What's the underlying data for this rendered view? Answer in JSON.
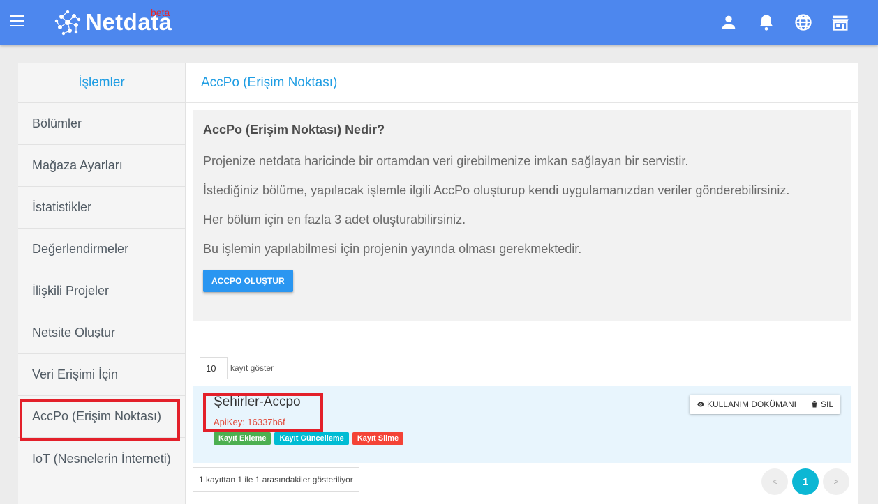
{
  "header": {
    "logo_text": "Netdata",
    "logo_badge": "beta",
    "icons": [
      "menu-icon",
      "user-icon",
      "bell-icon",
      "globe-icon",
      "store-icon"
    ]
  },
  "sidebar": {
    "title": "İşlemler",
    "items": [
      {
        "label": "Bölümler"
      },
      {
        "label": "Mağaza Ayarları"
      },
      {
        "label": "İstatistikler"
      },
      {
        "label": "Değerlendirmeler"
      },
      {
        "label": "İlişkili Projeler"
      },
      {
        "label": "Netsite Oluştur"
      },
      {
        "label": "Veri Erişimi İçin"
      },
      {
        "label": "AccPo (Erişim Noktası)"
      },
      {
        "label": "IoT (Nesnelerin İnterneti)"
      }
    ]
  },
  "content": {
    "title": "AccPo (Erişim Noktası)",
    "info": {
      "heading": "AccPo (Erişim Noktası) Nedir?",
      "p1": "Projenize netdata haricinde bir ortamdan veri girebilmenize imkan sağlayan bir servistir.",
      "p2": "İstediğiniz bölüme, yapılacak işlemle ilgili AccPo oluşturup kendi uygulamanızdan veriler gönderebilirsiniz.",
      "p3": "Her bölüm için en fazla 3 adet oluşturabilirsiniz.",
      "p4": "Bu işlemin yapılabilmesi için projenin yayında olması gerekmektedir.",
      "button": "ACCPO OLUŞTUR"
    },
    "length": {
      "value": "10",
      "label": "kayıt göster"
    },
    "rows": [
      {
        "name": "Şehirler-Accpo",
        "apikey": "ApiKey: 16337b6f",
        "badges": [
          {
            "label": "Kayıt Ekleme",
            "color": "#4caf50"
          },
          {
            "label": "Kayıt Güncelleme",
            "color": "#00bcd4"
          },
          {
            "label": "Kayıt Silme",
            "color": "#f44336"
          }
        ],
        "doc_button": "KULLANIM DOKÜMANI",
        "delete_button": "SIL"
      }
    ],
    "info_text": "1 kayıttan 1 ile 1 arasındakiler gösteriliyor",
    "pager": {
      "prev": "<",
      "current": "1",
      "next": ">"
    }
  },
  "colors": {
    "topbar": "#4d87ee",
    "accent": "#1f9de3",
    "highlight": "#e3202a"
  }
}
